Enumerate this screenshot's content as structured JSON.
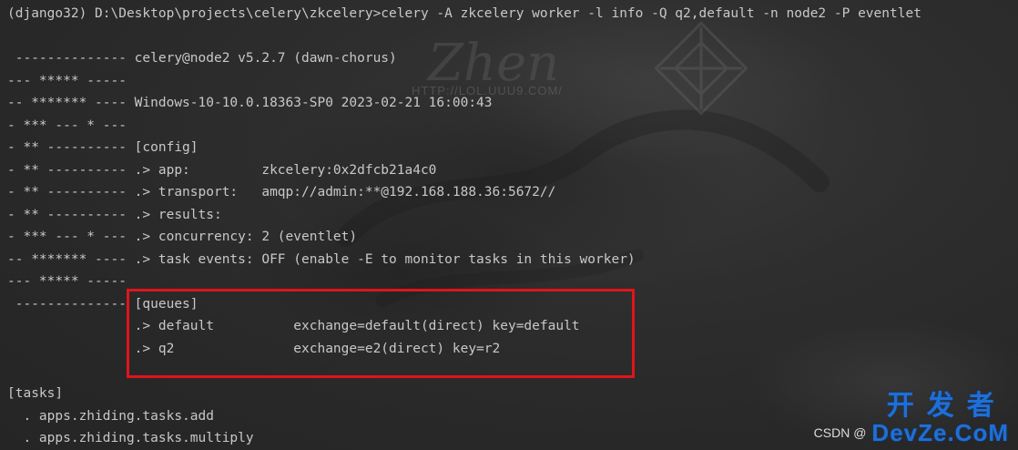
{
  "terminal": {
    "lines": [
      "(django32) D:\\Desktop\\projects\\celery\\zkcelery>celery -A zkcelery worker -l info -Q q2,default -n node2 -P eventlet",
      "",
      " -------------- celery@node2 v5.2.7 (dawn-chorus)",
      "--- ***** -----",
      "-- ******* ---- Windows-10-10.0.18363-SP0 2023-02-21 16:00:43",
      "- *** --- * ---",
      "- ** ---------- [config]",
      "- ** ---------- .> app:         zkcelery:0x2dfcb21a4c0",
      "- ** ---------- .> transport:   amqp://admin:**@192.168.188.36:5672//",
      "- ** ---------- .> results:",
      "- *** --- * --- .> concurrency: 2 (eventlet)",
      "-- ******* ---- .> task events: OFF (enable -E to monitor tasks in this worker)",
      "--- ***** -----",
      " -------------- [queues]",
      "                .> default          exchange=default(direct) key=default",
      "                .> q2               exchange=e2(direct) key=r2",
      "",
      "",
      "[tasks]",
      "  . apps.zhiding.tasks.add",
      "  . apps.zhiding.tasks.multiply"
    ]
  },
  "background_art": {
    "signature_text": "Zhen",
    "url_text": "HTTP://LOL.UUU9.COM/"
  },
  "watermark": {
    "csdn": "CSDN @",
    "brand_cn": "开发者",
    "brand_en": "DevZe.CoM"
  },
  "colors": {
    "background": "#2b2b2b",
    "text": "#c8c8c8",
    "highlight": "#e0141b",
    "brand": "#1f6fd6"
  }
}
